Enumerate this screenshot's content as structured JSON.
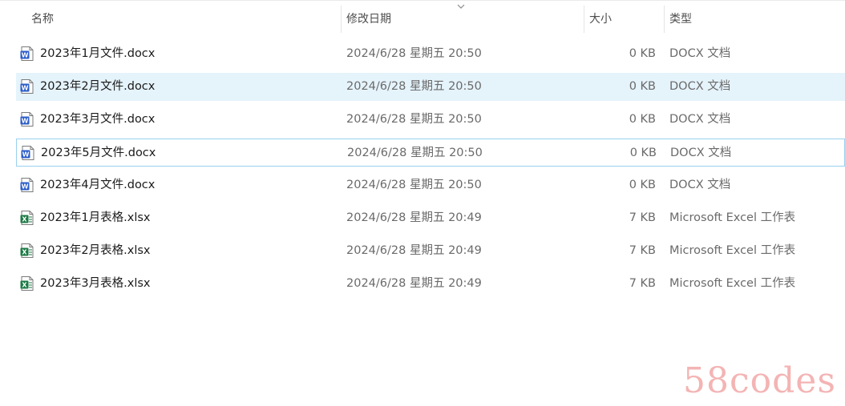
{
  "columns": {
    "name": "名称",
    "date": "修改日期",
    "size": "大小",
    "type": "类型"
  },
  "files": [
    {
      "name": "2023年1月文件.docx",
      "date": "2024/6/28 星期五 20:50",
      "size": "0 KB",
      "type": "DOCX 文档",
      "icon": "word-doc-icon",
      "state": "normal"
    },
    {
      "name": "2023年2月文件.docx",
      "date": "2024/6/28 星期五 20:50",
      "size": "0 KB",
      "type": "DOCX 文档",
      "icon": "word-doc-icon",
      "state": "selected"
    },
    {
      "name": "2023年3月文件.docx",
      "date": "2024/6/28 星期五 20:50",
      "size": "0 KB",
      "type": "DOCX 文档",
      "icon": "word-doc-icon",
      "state": "normal"
    },
    {
      "name": "2023年5月文件.docx",
      "date": "2024/6/28 星期五 20:50",
      "size": "0 KB",
      "type": "DOCX 文档",
      "icon": "word-doc-icon",
      "state": "focused"
    },
    {
      "name": "2023年4月文件.docx",
      "date": "2024/6/28 星期五 20:50",
      "size": "0 KB",
      "type": "DOCX 文档",
      "icon": "word-doc-icon",
      "state": "normal"
    },
    {
      "name": "2023年1月表格.xlsx",
      "date": "2024/6/28 星期五 20:49",
      "size": "7 KB",
      "type": "Microsoft Excel 工作表",
      "icon": "excel-sheet-icon",
      "state": "normal"
    },
    {
      "name": "2023年2月表格.xlsx",
      "date": "2024/6/28 星期五 20:49",
      "size": "7 KB",
      "type": "Microsoft Excel 工作表",
      "icon": "excel-sheet-icon",
      "state": "normal"
    },
    {
      "name": "2023年3月表格.xlsx",
      "date": "2024/6/28 星期五 20:49",
      "size": "7 KB",
      "type": "Microsoft Excel 工作表",
      "icon": "excel-sheet-icon",
      "state": "normal"
    }
  ],
  "colors": {
    "selected_bg": "#e5f3fb",
    "focus_border": "#99d1ee",
    "word_blue": "#2b5cc8",
    "excel_green": "#1d7a45",
    "watermark": "#f4b4b4"
  },
  "watermark": "58codes"
}
